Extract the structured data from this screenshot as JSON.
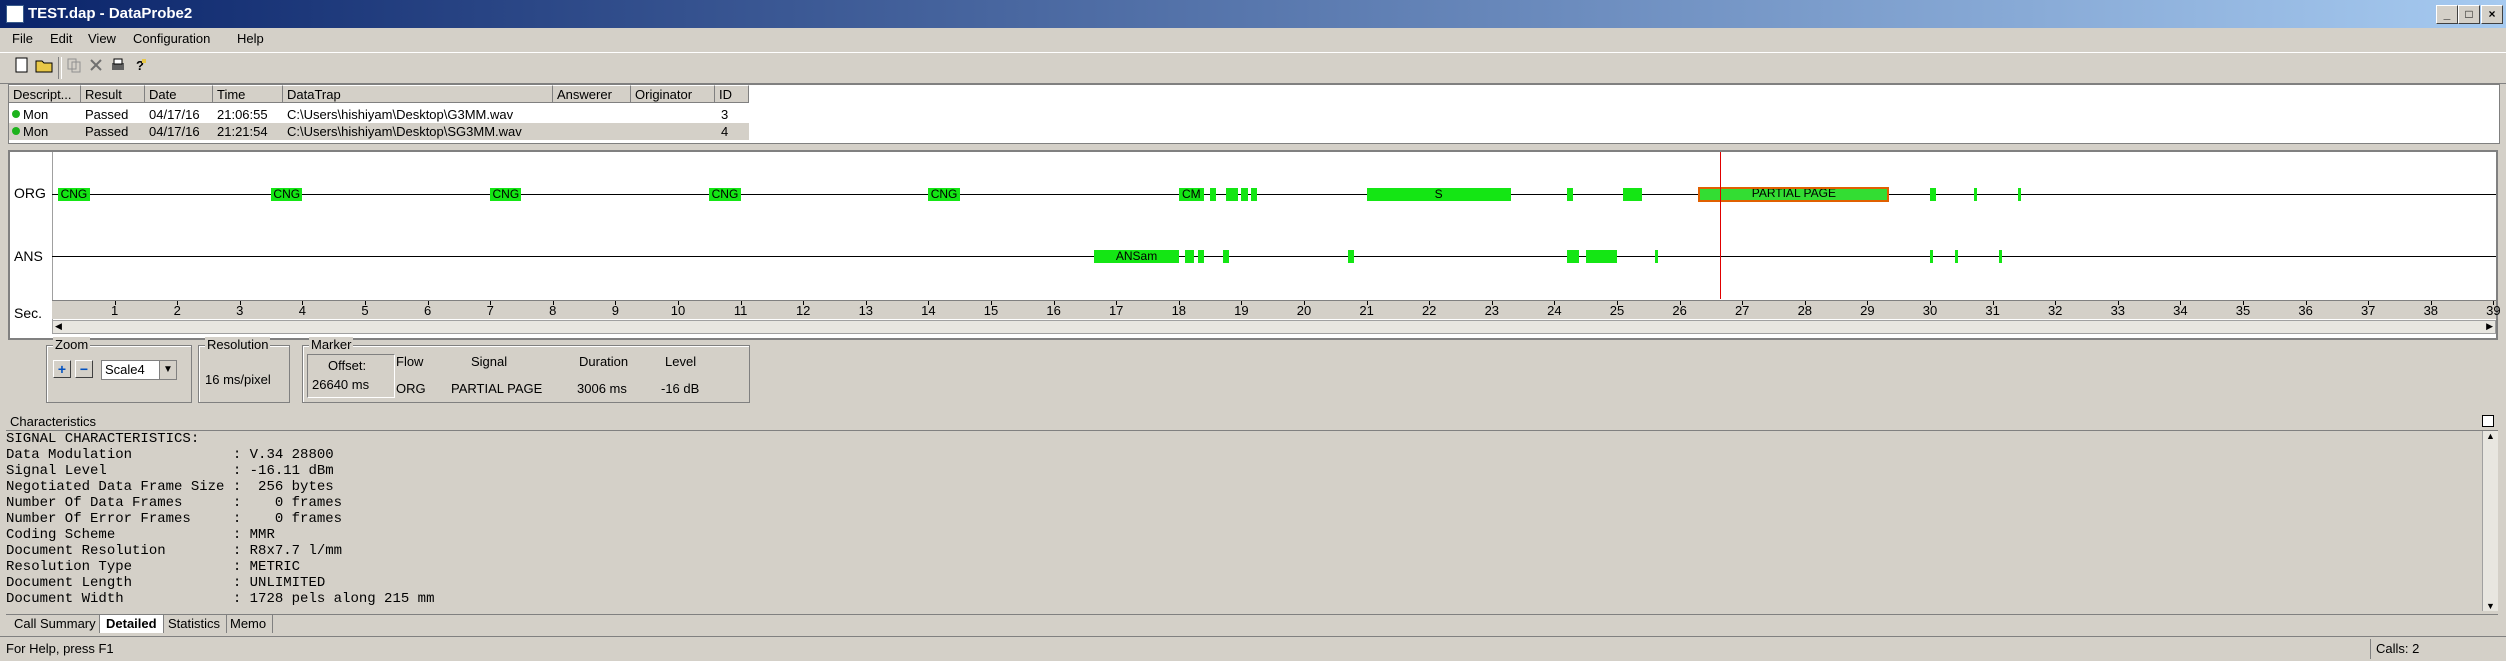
{
  "window": {
    "title": "TEST.dap - DataProbe2",
    "minimize": "_",
    "maximize": "□",
    "close": "×"
  },
  "menu": [
    "File",
    "Edit",
    "View",
    "Configuration",
    "Help"
  ],
  "calls": {
    "headers": [
      "Descript...",
      "Result",
      "Date",
      "Time",
      "DataTrap",
      "Answerer",
      "Originator",
      "ID"
    ],
    "rows": [
      {
        "desc": "Mon",
        "result": "Passed",
        "date": "04/17/16",
        "time": "21:06:55",
        "datatrap": "C:\\Users\\hishiyam\\Desktop\\G3MM.wav",
        "answerer": "",
        "originator": "",
        "id": "3"
      },
      {
        "desc": "Mon",
        "result": "Passed",
        "date": "04/17/16",
        "time": "21:21:54",
        "datatrap": "C:\\Users\\hishiyam\\Desktop\\SG3MM.wav",
        "answerer": "",
        "originator": "",
        "id": "4"
      }
    ]
  },
  "timeline": {
    "org_label": "ORG",
    "ans_label": "ANS",
    "sec_label": "Sec.",
    "ticks": [
      "1",
      "2",
      "3",
      "4",
      "5",
      "6",
      "7",
      "8",
      "9",
      "10",
      "11",
      "12",
      "13",
      "14",
      "15",
      "16",
      "17",
      "18",
      "19",
      "20",
      "21",
      "22",
      "23",
      "24",
      "25",
      "26",
      "27",
      "28",
      "29",
      "30",
      "31",
      "32",
      "33",
      "34",
      "35",
      "36",
      "37",
      "38",
      "39"
    ],
    "org_segments": [
      {
        "start": 0.1,
        "end": 0.6,
        "label": "CNG"
      },
      {
        "start": 3.5,
        "end": 4.0,
        "label": "CNG"
      },
      {
        "start": 7.0,
        "end": 7.5,
        "label": "CNG"
      },
      {
        "start": 10.5,
        "end": 11.0,
        "label": "CNG"
      },
      {
        "start": 14.0,
        "end": 14.5,
        "label": "CNG"
      },
      {
        "start": 18.0,
        "end": 18.4,
        "label": "CM"
      },
      {
        "start": 18.5,
        "end": 18.6,
        "label": ""
      },
      {
        "start": 18.75,
        "end": 18.95,
        "label": ""
      },
      {
        "start": 19.0,
        "end": 19.1,
        "label": ""
      },
      {
        "start": 19.15,
        "end": 19.25,
        "label": ""
      },
      {
        "start": 21.0,
        "end": 23.3,
        "label": "S"
      },
      {
        "start": 24.2,
        "end": 24.3,
        "label": ""
      },
      {
        "start": 25.1,
        "end": 25.4,
        "label": ""
      },
      {
        "start": 26.3,
        "end": 29.35,
        "label": "PARTIAL PAGE",
        "selected": true
      },
      {
        "start": 30.0,
        "end": 30.1,
        "label": ""
      },
      {
        "start": 30.7,
        "end": 30.75,
        "label": ""
      },
      {
        "start": 31.4,
        "end": 31.45,
        "label": ""
      }
    ],
    "ans_segments": [
      {
        "start": 16.65,
        "end": 18.0,
        "label": "ANSam"
      },
      {
        "start": 18.1,
        "end": 18.25,
        "label": ""
      },
      {
        "start": 18.3,
        "end": 18.4,
        "label": ""
      },
      {
        "start": 18.7,
        "end": 18.8,
        "label": ""
      },
      {
        "start": 20.7,
        "end": 20.8,
        "label": ""
      },
      {
        "start": 24.2,
        "end": 24.4,
        "label": ""
      },
      {
        "start": 24.5,
        "end": 25.0,
        "label": ""
      },
      {
        "start": 25.6,
        "end": 25.65,
        "label": ""
      },
      {
        "start": 30.0,
        "end": 30.05,
        "label": ""
      },
      {
        "start": 30.4,
        "end": 30.45,
        "label": ""
      },
      {
        "start": 31.1,
        "end": 31.15,
        "label": ""
      }
    ],
    "marker_sec": 26.64
  },
  "zoom": {
    "title": "Zoom",
    "plus": "+",
    "minus": "−",
    "scale": "Scale4"
  },
  "resolution": {
    "title": "Resolution",
    "value": "16 ms/pixel"
  },
  "marker": {
    "title": "Marker",
    "offset_label": "Offset:",
    "offset_value": "26640 ms",
    "headers": [
      "Flow",
      "Signal",
      "Duration",
      "Level"
    ],
    "values": [
      "ORG",
      "PARTIAL PAGE",
      "3006 ms",
      "-16 dB"
    ]
  },
  "characteristics": {
    "title": "Characteristics",
    "lines": [
      "SIGNAL CHARACTERISTICS:",
      "Data Modulation            : V.34 28800",
      "Signal Level               : -16.11 dBm",
      "Negotiated Data Frame Size :  256 bytes",
      "Number Of Data Frames      :    0 frames",
      "Number Of Error Frames     :    0 frames",
      "Coding Scheme              : MMR",
      "Document Resolution        : R8x7.7 l/mm",
      "Resolution Type            : METRIC",
      "Document Length            : UNLIMITED",
      "Document Width             : 1728 pels along 215 mm"
    ]
  },
  "tabs": [
    "Call Summary",
    "Detailed",
    "Statistics",
    "Memo"
  ],
  "active_tab": 1,
  "status": {
    "help": "For Help, press F1",
    "calls": "Calls: 2"
  },
  "colors": {
    "segment": "#14e614",
    "marker": "#e00000",
    "selected_border": "#e06000",
    "titlebar": "#0a246a"
  }
}
